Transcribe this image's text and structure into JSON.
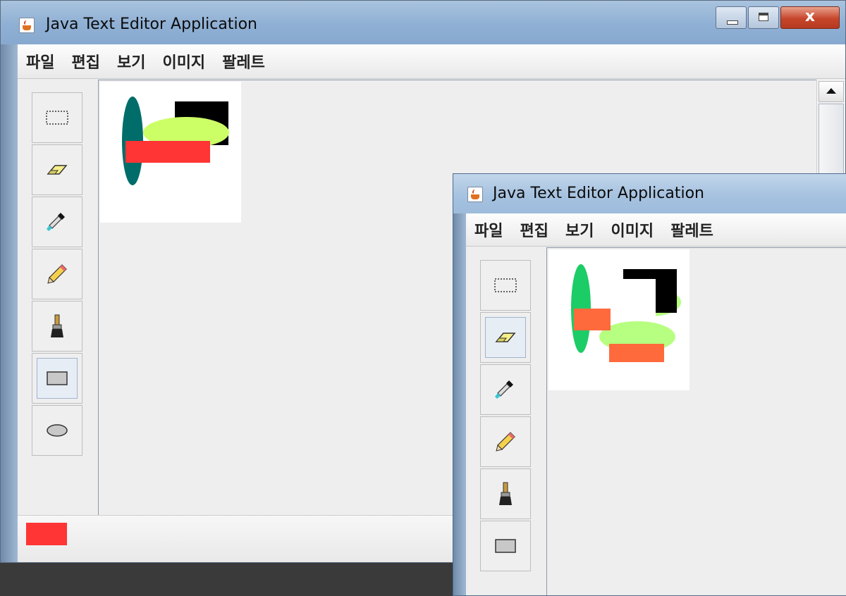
{
  "windows": [
    {
      "title": "Java Text Editor Application",
      "menu": [
        "파일",
        "편집",
        "보기",
        "이미지",
        "팔레트"
      ],
      "tools": [
        "select-rect",
        "eraser",
        "eyedropper",
        "pencil",
        "brush",
        "rectangle",
        "ellipse"
      ],
      "selected_tool": "rectangle",
      "current_color": "#ff3535",
      "shapes": {
        "ellipse_teal": "#006d6a",
        "ellipse_lime": "#ccff66",
        "rect_black": "#000000",
        "rect_red": "#ff3535"
      }
    },
    {
      "title": "Java Text Editor Application",
      "menu": [
        "파일",
        "편집",
        "보기",
        "이미지",
        "팔레트"
      ],
      "tools": [
        "select-rect",
        "eraser",
        "eyedropper",
        "pencil",
        "brush",
        "rectangle"
      ],
      "selected_tool": "eraser",
      "shapes": {
        "ellipse_green": "#1ccc66",
        "ellipse_lime": "#b6ff80",
        "rect_black": "#000000",
        "rect_orange": "#ff6a3d"
      }
    }
  ]
}
